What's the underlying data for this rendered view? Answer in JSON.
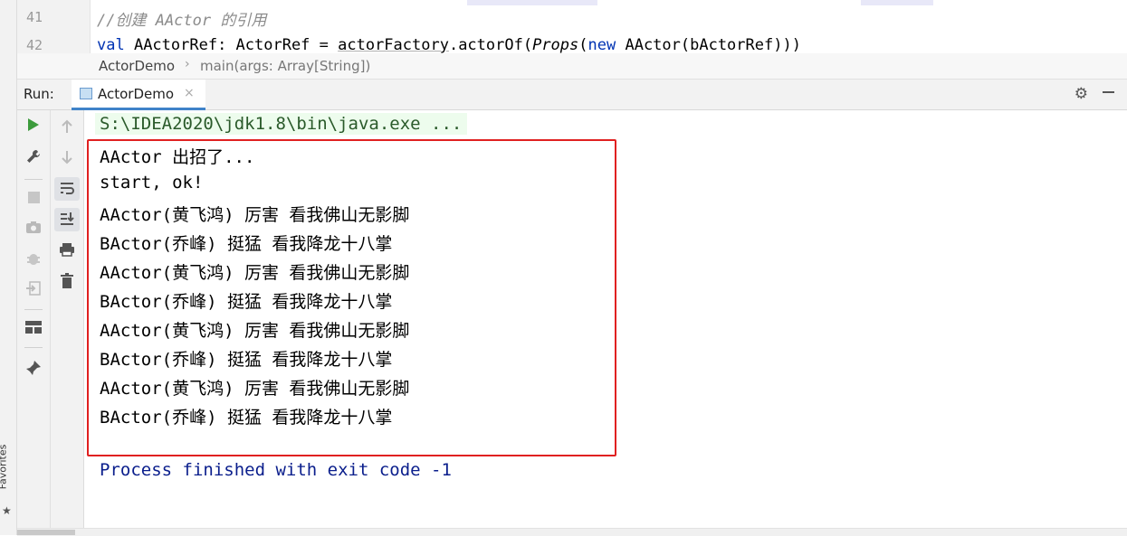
{
  "favorites": {
    "label": "Favorites",
    "icon": "star-icon"
  },
  "editor": {
    "lines": [
      {
        "number": "41",
        "comment": "//创建 AActor 的引用"
      },
      {
        "number": "42",
        "keyword": "val",
        "name_part": " AActorRef: ActorRef = ",
        "call": "actorFactory",
        "call_rest": ".actorOf(",
        "props": "Props",
        "paren": "(",
        "new_kw": "new",
        "rest": " AActor(bActorRef)))"
      }
    ]
  },
  "breadcrumb": {
    "class_name": "ActorDemo",
    "separator": "›",
    "method": "main(args: Array[String])"
  },
  "run_panel": {
    "label": "Run:",
    "tab": {
      "label": "ActorDemo",
      "close": "×"
    },
    "gear_icon": "gear-icon",
    "minimize_icon": "minimize-icon"
  },
  "console": {
    "command": "S:\\IDEA2020\\jdk1.8\\bin\\java.exe ...",
    "output": [
      "AActor 出招了...",
      "start, ok!",
      "AActor(黄飞鸿) 厉害 看我佛山无影脚",
      "BActor(乔峰) 挺猛 看我降龙十八掌",
      "AActor(黄飞鸿) 厉害 看我佛山无影脚",
      "BActor(乔峰) 挺猛 看我降龙十八掌",
      "AActor(黄飞鸿) 厉害 看我佛山无影脚",
      "BActor(乔峰) 挺猛 看我降龙十八掌",
      "AActor(黄飞鸿) 厉害 看我佛山无影脚",
      "BActor(乔峰) 挺猛 看我降龙十八掌"
    ],
    "exit_message": "Process finished with exit code -1"
  },
  "colors": {
    "highlight_box": "#e02020",
    "run_icon": "#3c9b3c",
    "exit_text": "#0a1e8c",
    "command_bg": "#edfced"
  }
}
